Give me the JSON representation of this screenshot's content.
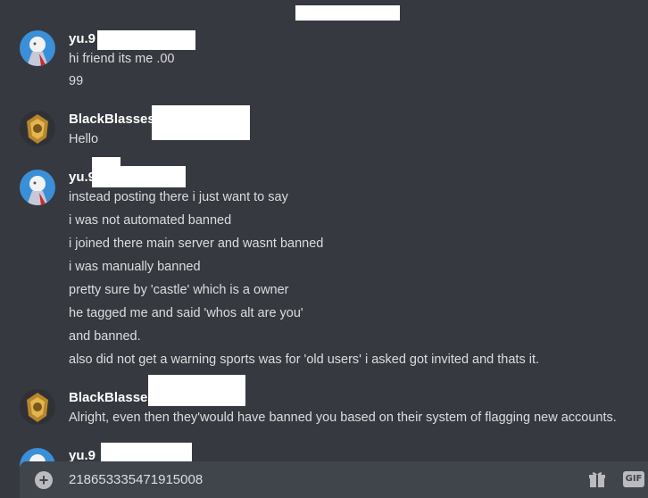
{
  "messages": [
    {
      "username": "yu.9",
      "avatar_icon": "anime-character-avatar-icon",
      "lines": [
        "hi friend its me .00",
        "99"
      ]
    },
    {
      "username": "BlackBlasses",
      "avatar_icon": "gold-emblem-avatar-icon",
      "lines": [
        "Hello"
      ]
    },
    {
      "username": "yu.9",
      "avatar_icon": "anime-character-avatar-icon",
      "lines": [
        "instead posting there i just want to say",
        "i was not automated banned",
        "i joined there main server and wasnt banned",
        "i was manually banned",
        "pretty sure by 'castle' which is  a owner",
        "he tagged me and said 'whos alt are you'",
        "and banned.",
        "also did not get a warning sports was for 'old users' i asked got invited and thats it."
      ]
    },
    {
      "username": "BlackBlasses",
      "avatar_icon": "gold-emblem-avatar-icon",
      "lines": [
        "Alright, even then they'would have banned you based on their system of flagging new accounts."
      ]
    },
    {
      "username": "yu.9",
      "avatar_icon": "anime-character-avatar-icon",
      "lines": []
    }
  ],
  "composer": {
    "value": "218653335471915008",
    "add_icon": "plus-circle-icon",
    "gift_icon": "gift-icon",
    "gif_label": "GIF"
  },
  "colors": {
    "background": "#36393f",
    "composer_bg": "#40444b",
    "text": "#dcddde",
    "username": "#ffffff"
  }
}
